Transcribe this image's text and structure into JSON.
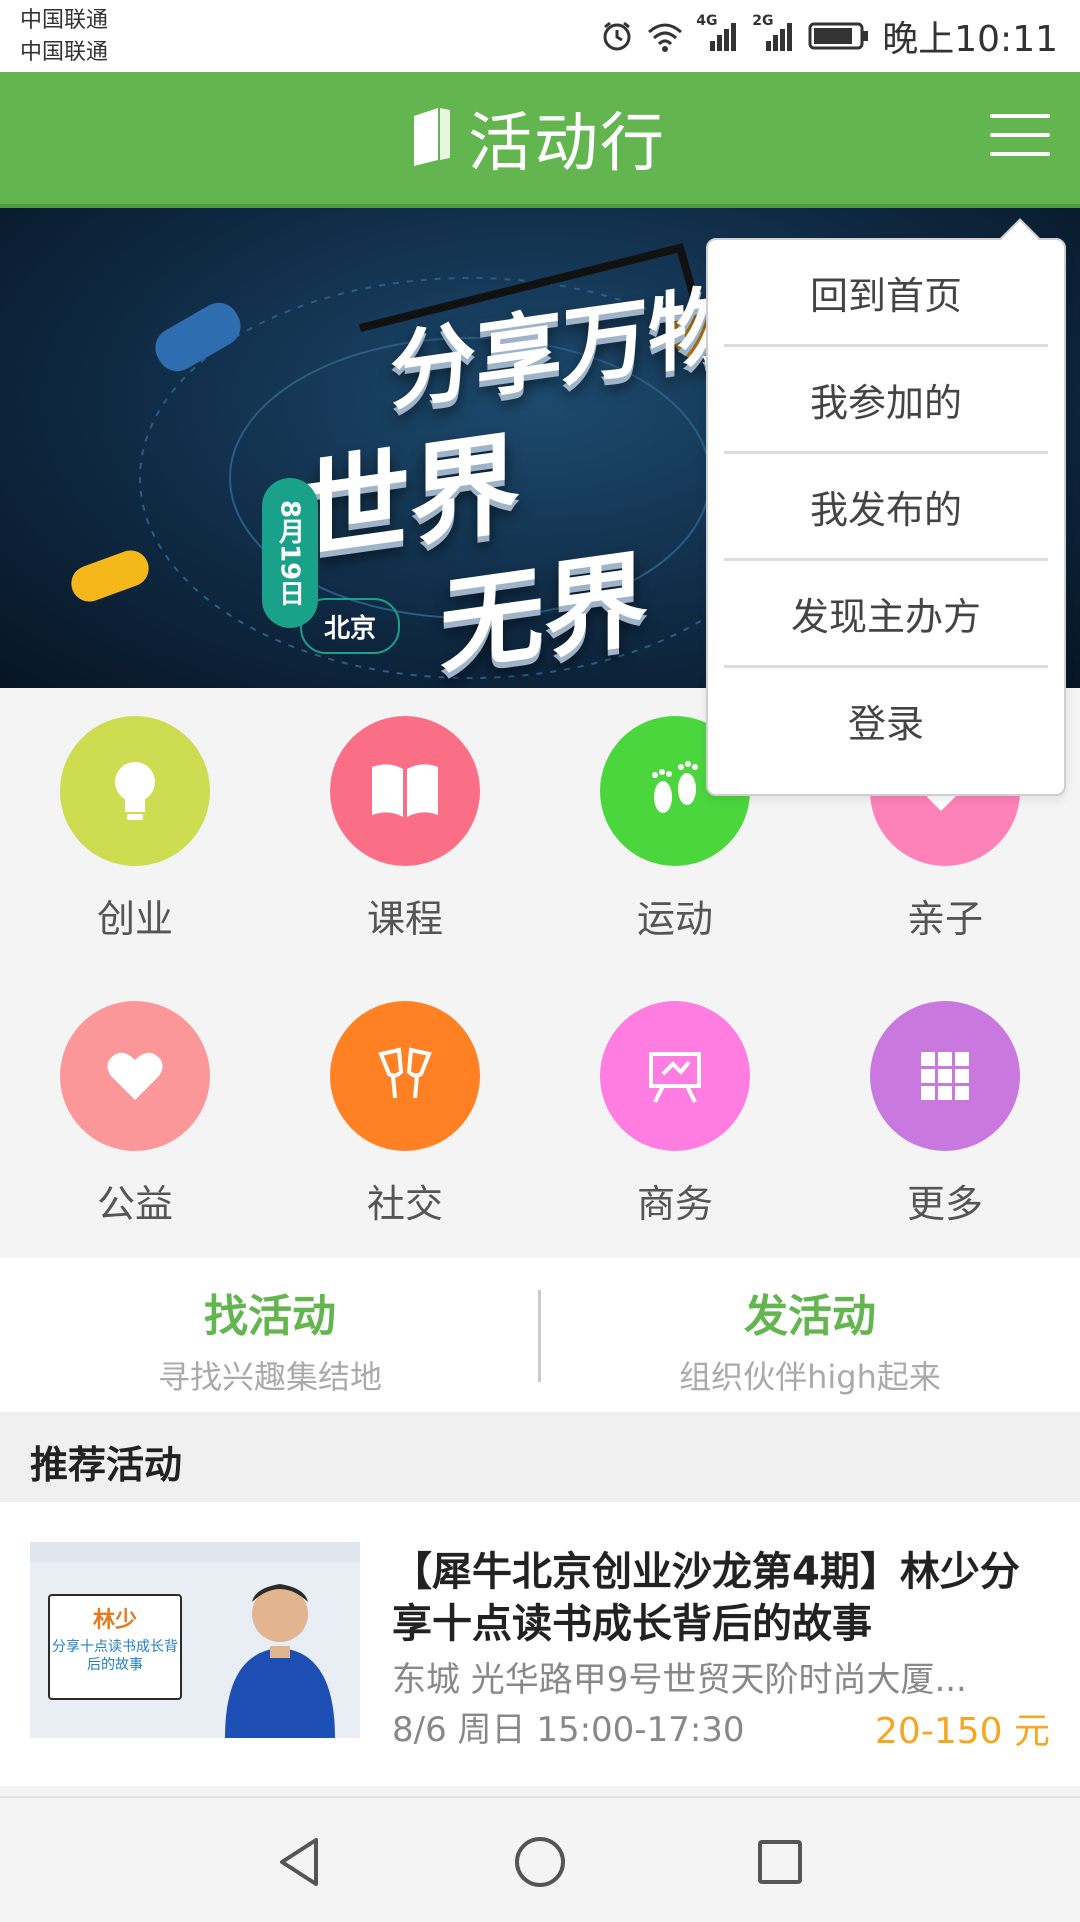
{
  "status_bar": {
    "carrier_1": "中国联通",
    "carrier_2": "中国联通",
    "net_1": "4G",
    "net_2": "2G",
    "time": "晚上10:11"
  },
  "app": {
    "title": "活动行"
  },
  "banner": {
    "line1": "分享万物",
    "line2": "世界",
    "line3": "无界",
    "date": "8月19日",
    "city": "北京",
    "dots": 6,
    "active_dot": 0
  },
  "categories": [
    {
      "label": "创业",
      "color": "#cddc51",
      "icon": "lightbulb-icon"
    },
    {
      "label": "课程",
      "color": "#fb6f86",
      "icon": "book-icon"
    },
    {
      "label": "运动",
      "color": "#4cd63e",
      "icon": "footprints-icon"
    },
    {
      "label": "亲子",
      "color": "#fd82b8",
      "icon": "balloon-icon"
    },
    {
      "label": "公益",
      "color": "#fc9799",
      "icon": "heart-icon"
    },
    {
      "label": "社交",
      "color": "#ff8124",
      "icon": "cheers-icon"
    },
    {
      "label": "商务",
      "color": "#ff7ce0",
      "icon": "presentation-icon"
    },
    {
      "label": "更多",
      "color": "#c878df",
      "icon": "grid-icon"
    }
  ],
  "actions": {
    "find": {
      "title": "找活动",
      "subtitle": "寻找兴趣集结地"
    },
    "publish": {
      "title": "发活动",
      "subtitle": "组织伙伴high起来"
    }
  },
  "section": {
    "title": "推荐活动"
  },
  "event": {
    "title": "【犀牛北京创业沙龙第4期】林少分享十点读书成长背后的故事",
    "address": "东城 光华路甲9号世贸天阶时尚大厦...",
    "time": "8/6 周日 15:00-17:30",
    "price": "20-150 元",
    "thumb_name": "林少",
    "thumb_caption": "分享十点读书成长背后的故事"
  },
  "dropdown": {
    "items": [
      "回到首页",
      "我参加的",
      "我发布的",
      "发现主办方",
      "登录"
    ]
  },
  "colors": {
    "brand_green": "#62b54f",
    "price_orange": "#f5a623"
  }
}
